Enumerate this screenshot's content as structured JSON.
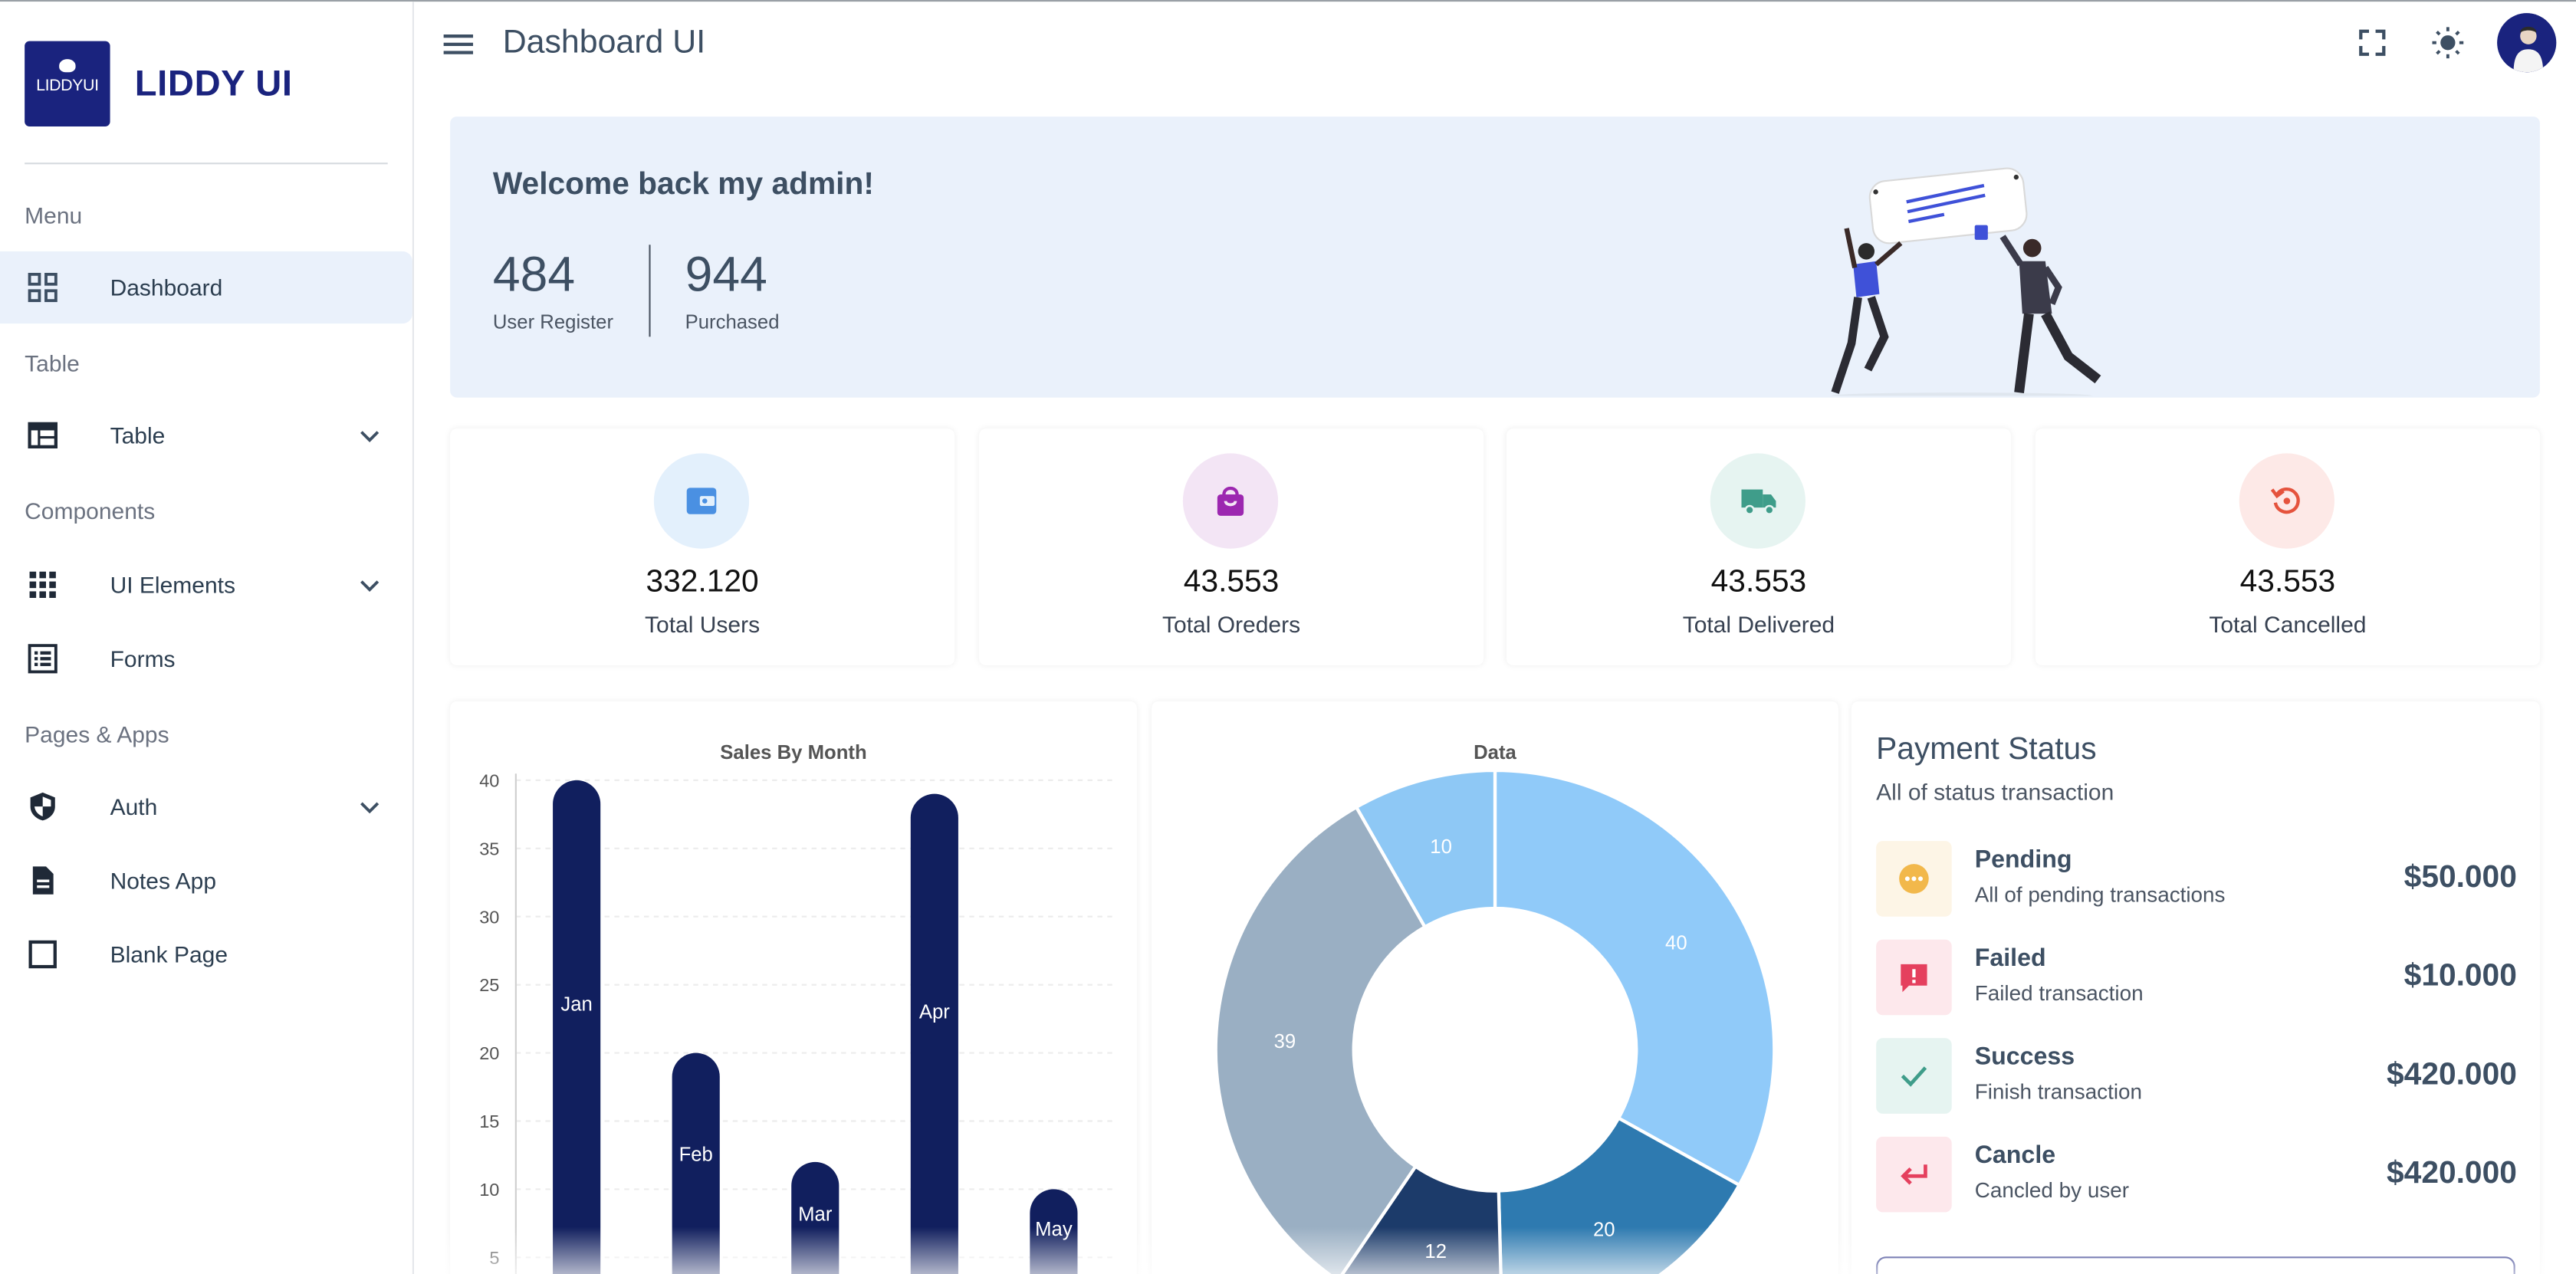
{
  "brand": {
    "logo_text": "LIDDYUI",
    "name": "LIDDY UI"
  },
  "sidebar": {
    "sections": [
      "Menu",
      "Table",
      "Components",
      "Pages & Apps"
    ],
    "items": [
      {
        "label": "Dashboard",
        "icon": "grid-icon"
      },
      {
        "label": "Table",
        "icon": "table-icon"
      },
      {
        "label": "UI Elements",
        "icon": "apps-icon"
      },
      {
        "label": "Forms",
        "icon": "list-icon"
      },
      {
        "label": "Auth",
        "icon": "shield-icon"
      },
      {
        "label": "Notes App",
        "icon": "note-icon"
      },
      {
        "label": "Blank Page",
        "icon": "square-icon"
      }
    ]
  },
  "header": {
    "title": "Dashboard UI"
  },
  "welcome": {
    "title": "Welcome back my admin!",
    "stats": [
      {
        "value": "484",
        "label": "User Register"
      },
      {
        "value": "944",
        "label": "Purchased"
      }
    ]
  },
  "cards": [
    {
      "value": "332.120",
      "label": "Total Users",
      "icon": "wallet-icon",
      "color": "#4a90e2",
      "bg": "#e3f0fc"
    },
    {
      "value": "43.553",
      "label": "Total Oreders",
      "icon": "shopping-bag-icon",
      "color": "#9c27b0",
      "bg": "#f3e5f5"
    },
    {
      "value": "43.553",
      "label": "Total Delivered",
      "icon": "truck-icon",
      "color": "#3f9d8a",
      "bg": "#e6f4f1"
    },
    {
      "value": "43.553",
      "label": "Total Cancelled",
      "icon": "refresh-icon",
      "color": "#e5533d",
      "bg": "#fde9e7"
    }
  ],
  "chart_data": [
    {
      "type": "bar",
      "title": "Sales By Month",
      "categories": [
        "Jan",
        "Feb",
        "Mar",
        "Apr",
        "May"
      ],
      "values": [
        40,
        20,
        12,
        39,
        10
      ],
      "yticks": [
        "40",
        "35",
        "30",
        "25",
        "20",
        "15",
        "10",
        "5"
      ],
      "ylim": [
        0,
        40
      ],
      "color": "#111f5e",
      "grid": true
    },
    {
      "type": "pie",
      "title": "Data",
      "labels": [
        "40",
        "20",
        "12",
        "39",
        "10"
      ],
      "values": [
        40,
        20,
        12,
        39,
        10
      ],
      "colors": [
        "#90caf9",
        "#2e7ab0",
        "#1c3b6a",
        "#9aafc3",
        "#8ec8f5"
      ]
    }
  ],
  "payment": {
    "title": "Payment Status",
    "subtitle": "All of status transaction",
    "rows": [
      {
        "name": "Pending",
        "desc": "All of pending transactions",
        "amount": "$50.000",
        "icon": "more-icon",
        "color": "#f2b84b",
        "bg": "#fdf5e6"
      },
      {
        "name": "Failed",
        "desc": "Failed transaction",
        "amount": "$10.000",
        "icon": "alert-icon",
        "color": "#e5405e",
        "bg": "#fde8ec"
      },
      {
        "name": "Success",
        "desc": "Finish transaction",
        "amount": "$420.000",
        "icon": "check-icon",
        "color": "#3f9d8a",
        "bg": "#e6f4f1"
      },
      {
        "name": "Cancle",
        "desc": "Cancled by user",
        "amount": "$420.000",
        "icon": "return-icon",
        "color": "#e5405e",
        "bg": "#fde8ec"
      }
    ]
  }
}
